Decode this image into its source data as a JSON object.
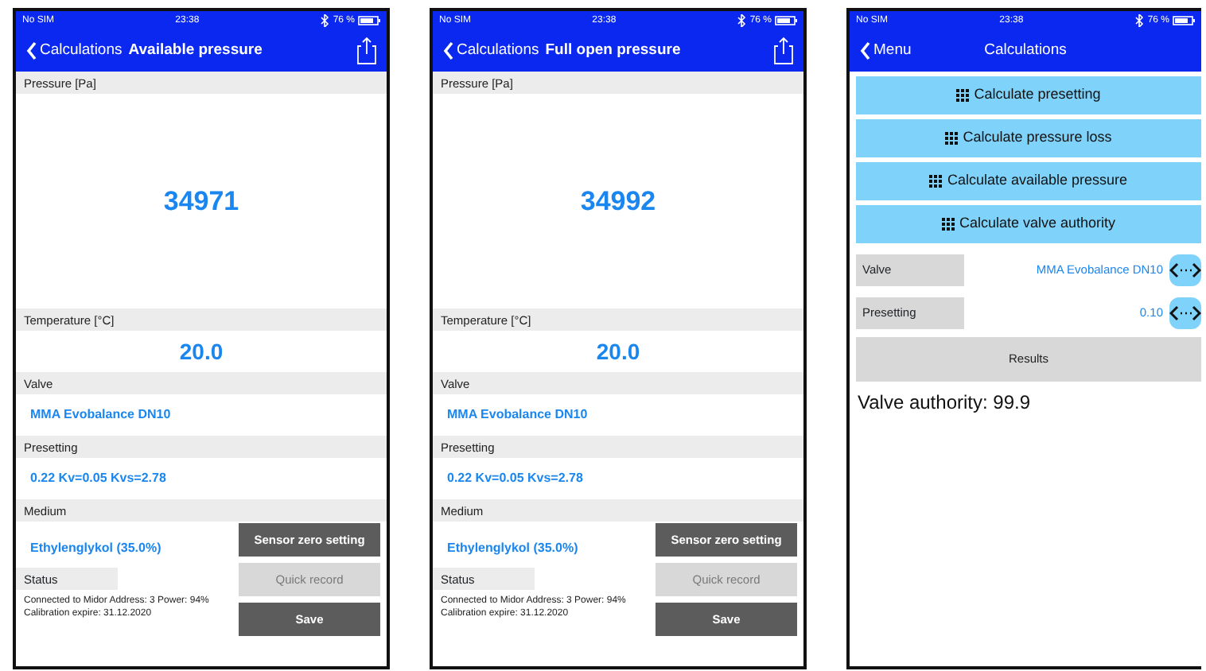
{
  "screens": [
    {
      "kind": "measurement",
      "status_bar": {
        "carrier": "No SIM",
        "time": "23:38",
        "battery": "76 %"
      },
      "nav": {
        "back": "Calculations",
        "title": "Available pressure"
      },
      "fields": [
        {
          "kind": "big",
          "label": "Pressure [Pa]",
          "value": "34971"
        },
        {
          "kind": "medium",
          "label": "Temperature [°C]",
          "value": "20.0"
        },
        {
          "kind": "line",
          "label": "Valve",
          "value": "MMA Evobalance DN10"
        },
        {
          "kind": "line",
          "label": "Presetting",
          "value": "0.22 Kv=0.05 Kvs=2.78"
        }
      ],
      "medium": {
        "label": "Medium",
        "value": "Ethylenglykol (35.0%)"
      },
      "status": {
        "label": "Status",
        "text": "Connected to Midor Address: 3 Power: 94% Calibration expire: 31.12.2020"
      },
      "buttons": [
        {
          "label": "Sensor zero setting",
          "disabled": false
        },
        {
          "label": "Quick record",
          "disabled": true
        },
        {
          "label": "Save",
          "disabled": false
        }
      ]
    },
    {
      "kind": "measurement",
      "status_bar": {
        "carrier": "No SIM",
        "time": "23:38",
        "battery": "76 %"
      },
      "nav": {
        "back": "Calculations",
        "title": "Full open pressure"
      },
      "fields": [
        {
          "kind": "big",
          "label": "Pressure [Pa]",
          "value": "34992"
        },
        {
          "kind": "medium",
          "label": "Temperature [°C]",
          "value": "20.0"
        },
        {
          "kind": "line",
          "label": "Valve",
          "value": "MMA Evobalance DN10"
        },
        {
          "kind": "line",
          "label": "Presetting",
          "value": "0.22 Kv=0.05 Kvs=2.78"
        }
      ],
      "medium": {
        "label": "Medium",
        "value": "Ethylenglykol (35.0%)"
      },
      "status": {
        "label": "Status",
        "text": "Connected to Midor Address: 3 Power: 94% Calibration expire: 31.12.2020"
      },
      "buttons": [
        {
          "label": "Sensor zero setting",
          "disabled": false
        },
        {
          "label": "Quick record",
          "disabled": true
        },
        {
          "label": "Save",
          "disabled": false
        }
      ]
    },
    {
      "kind": "menu",
      "status_bar": {
        "carrier": "No SIM",
        "time": "23:38",
        "battery": "76 %"
      },
      "nav": {
        "back": "Menu",
        "title": "Calculations"
      },
      "actions": [
        "Calculate presetting",
        "Calculate pressure loss",
        "Calculate available pressure",
        "Calculate valve authority"
      ],
      "inputs": [
        {
          "label": "Valve",
          "value": "MMA Evobalance DN10"
        },
        {
          "label": "Presetting",
          "value": "0.10"
        }
      ],
      "results_button": "Results",
      "result": "Valve authority: 99.9"
    }
  ]
}
